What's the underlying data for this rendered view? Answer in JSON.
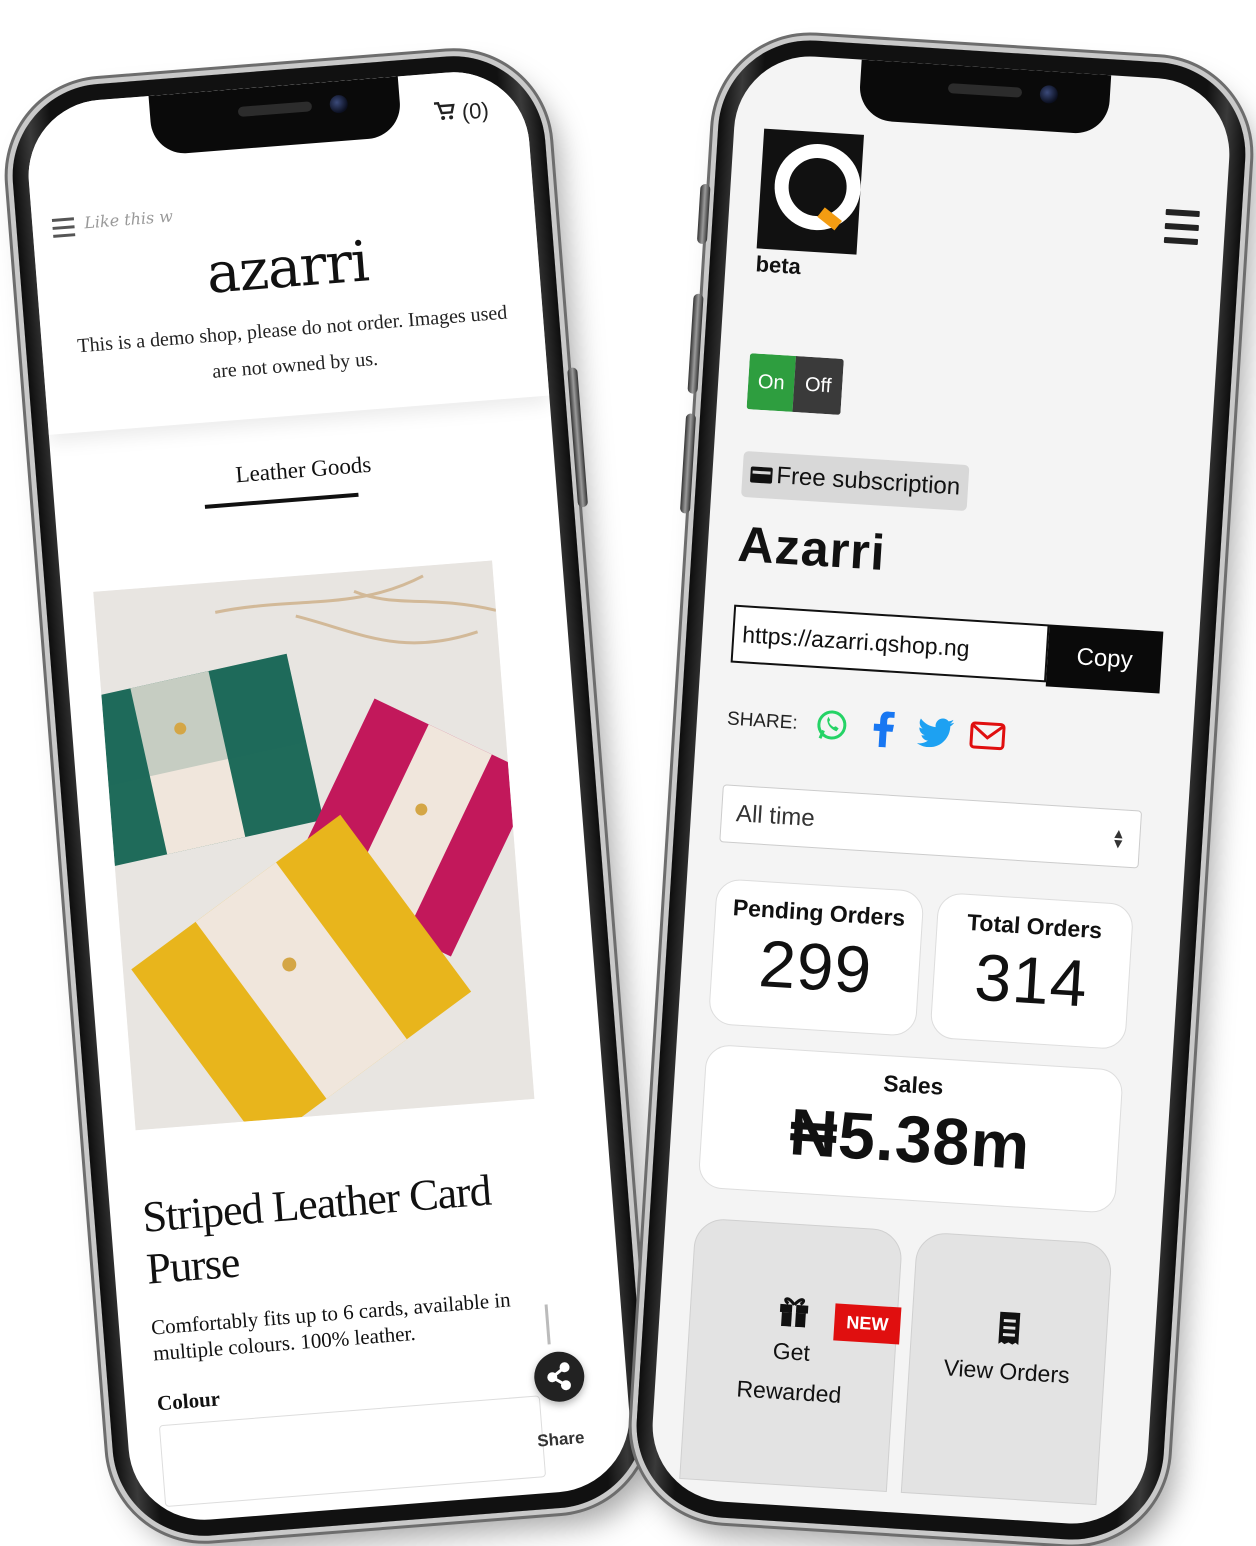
{
  "shop": {
    "cart_label": "(0)",
    "banner_text": "Like this w",
    "name": "azarri",
    "description": "This is a demo shop, please do not order. Images used are not owned by us.",
    "category": "Leather Goods",
    "product": {
      "title": "Striped Leather Card Purse",
      "description": "Comfortably fits up to 6 cards, available in multiple colours. 100% leather.",
      "colour_label": "Colour"
    },
    "share_label": "Share"
  },
  "dashboard": {
    "logo_letter": "Q",
    "logo_tag": "beta",
    "toggle": {
      "on": "On",
      "off": "Off"
    },
    "subscription": "Free subscription",
    "store_name": "Azarri",
    "store_url": "https://azarri.qshop.ng",
    "copy_label": "Copy",
    "share_label": "SHARE:",
    "range": "All time",
    "stats": {
      "pending_label": "Pending Orders",
      "pending_value": "299",
      "total_label": "Total Orders",
      "total_value": "314",
      "sales_label": "Sales",
      "sales_value": "₦5.38m"
    },
    "actions": {
      "rewards_label_1": "Get",
      "rewards_label_2": "Rewarded",
      "new_badge": "NEW",
      "orders_label": "View Orders"
    }
  },
  "colors": {
    "toggle_on": "#2e9e3f",
    "whatsapp": "#25d366",
    "facebook": "#1877f2",
    "twitter": "#1da1f2",
    "email": "#e00f0f",
    "new_badge": "#e00f0f"
  }
}
